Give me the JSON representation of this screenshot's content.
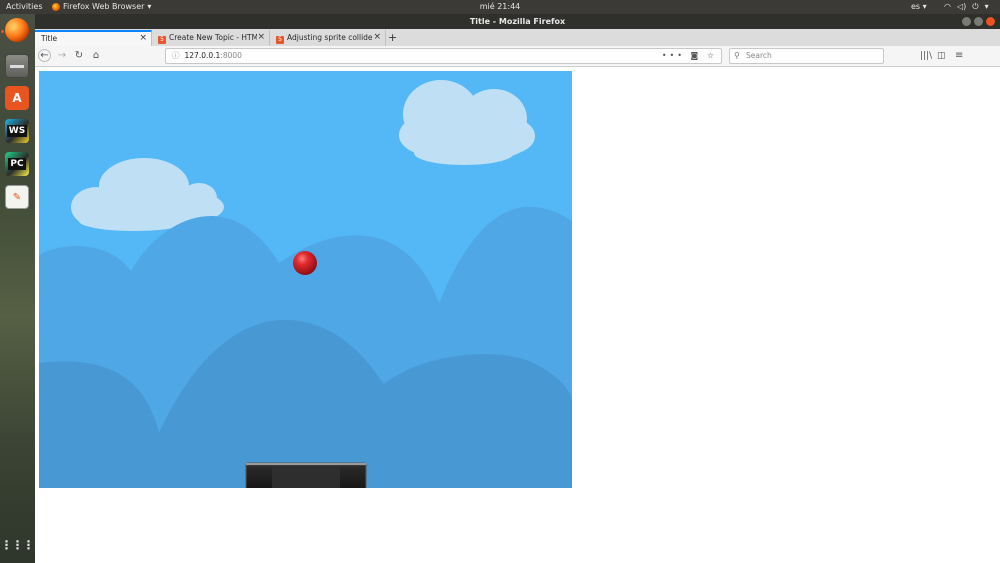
{
  "system": {
    "activities": "Activities",
    "app_menu": "Firefox Web Browser",
    "clock": "mié 21:44",
    "language": "es"
  },
  "window": {
    "title": "Title - Mozilla Firefox"
  },
  "tabs": [
    {
      "label": "Title",
      "active": true
    },
    {
      "label": "Create New Topic - HTML",
      "active": false
    },
    {
      "label": "Adjusting sprite collider",
      "active": false
    }
  ],
  "navbar": {
    "url_host": "127.0.0.1",
    "url_port": ":8000",
    "search_placeholder": "Search"
  },
  "dock": {
    "apps": [
      "firefox-icon",
      "files-icon",
      "software-center-icon",
      "webstorm-icon",
      "pycharm-icon",
      "text-editor-icon"
    ],
    "webstorm_label": "WS",
    "pycharm_label": "PC"
  },
  "colors": {
    "sky": "#55b8f6",
    "hills_far": "#4fa7e6",
    "hills_near": "#4898d4",
    "cloud": "#bfe0f4",
    "ball": "#c8171e",
    "paddle": "#1e1e1e",
    "accent": "#e95420"
  }
}
